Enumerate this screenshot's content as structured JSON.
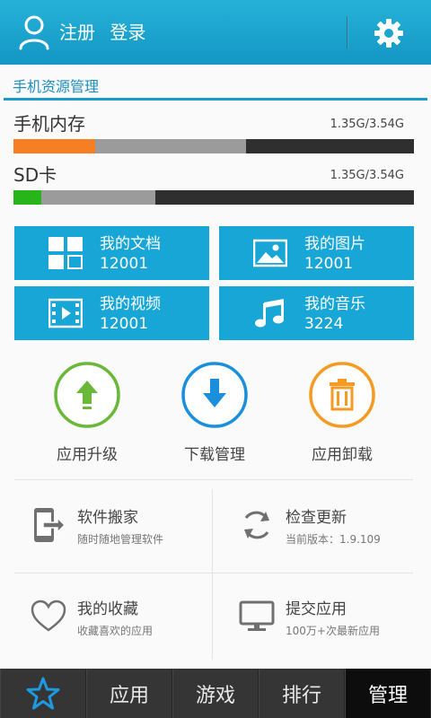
{
  "header": {
    "register": "注册",
    "login": "登录"
  },
  "section": {
    "title": "手机资源管理"
  },
  "storage": [
    {
      "label": "手机内存",
      "value": "1.35G/3.54G",
      "used_fraction": 0.205,
      "cached_fraction": 0.58,
      "color": "#f57f22"
    },
    {
      "label": "SD卡",
      "value": "1.35G/3.54G",
      "used_fraction": 0.07,
      "cached_fraction": 0.355,
      "color": "#28b51a"
    }
  ],
  "tiles": [
    {
      "name": "我的文档",
      "count": "12001",
      "icon": "grid-icon"
    },
    {
      "name": "我的图片",
      "count": "12001",
      "icon": "image-icon"
    },
    {
      "name": "我的视频",
      "count": "12001",
      "icon": "video-icon"
    },
    {
      "name": "我的音乐",
      "count": "3224",
      "icon": "music-icon"
    }
  ],
  "actions": [
    {
      "label": "应用升级",
      "color": "#69b83a",
      "icon": "arrow-up-icon"
    },
    {
      "label": "下载管理",
      "color": "#1b8fdc",
      "icon": "arrow-down-icon"
    },
    {
      "label": "应用卸载",
      "color": "#f59a23",
      "icon": "trash-icon"
    }
  ],
  "features": [
    {
      "title": "软件搬家",
      "subtitle": "随时随地管理软件",
      "icon": "phone-move-icon"
    },
    {
      "title": "检查更新",
      "subtitle": "当前版本：1.9.109",
      "icon": "refresh-icon"
    },
    {
      "title": "我的收藏",
      "subtitle": "收藏喜欢的应用",
      "icon": "heart-icon"
    },
    {
      "title": "提交应用",
      "subtitle": "100万+次最新应用",
      "icon": "monitor-icon"
    }
  ],
  "nav": [
    {
      "label": "",
      "icon": "star-icon"
    },
    {
      "label": "应用"
    },
    {
      "label": "游戏"
    },
    {
      "label": "排行"
    },
    {
      "label": "管理",
      "active": true
    }
  ]
}
